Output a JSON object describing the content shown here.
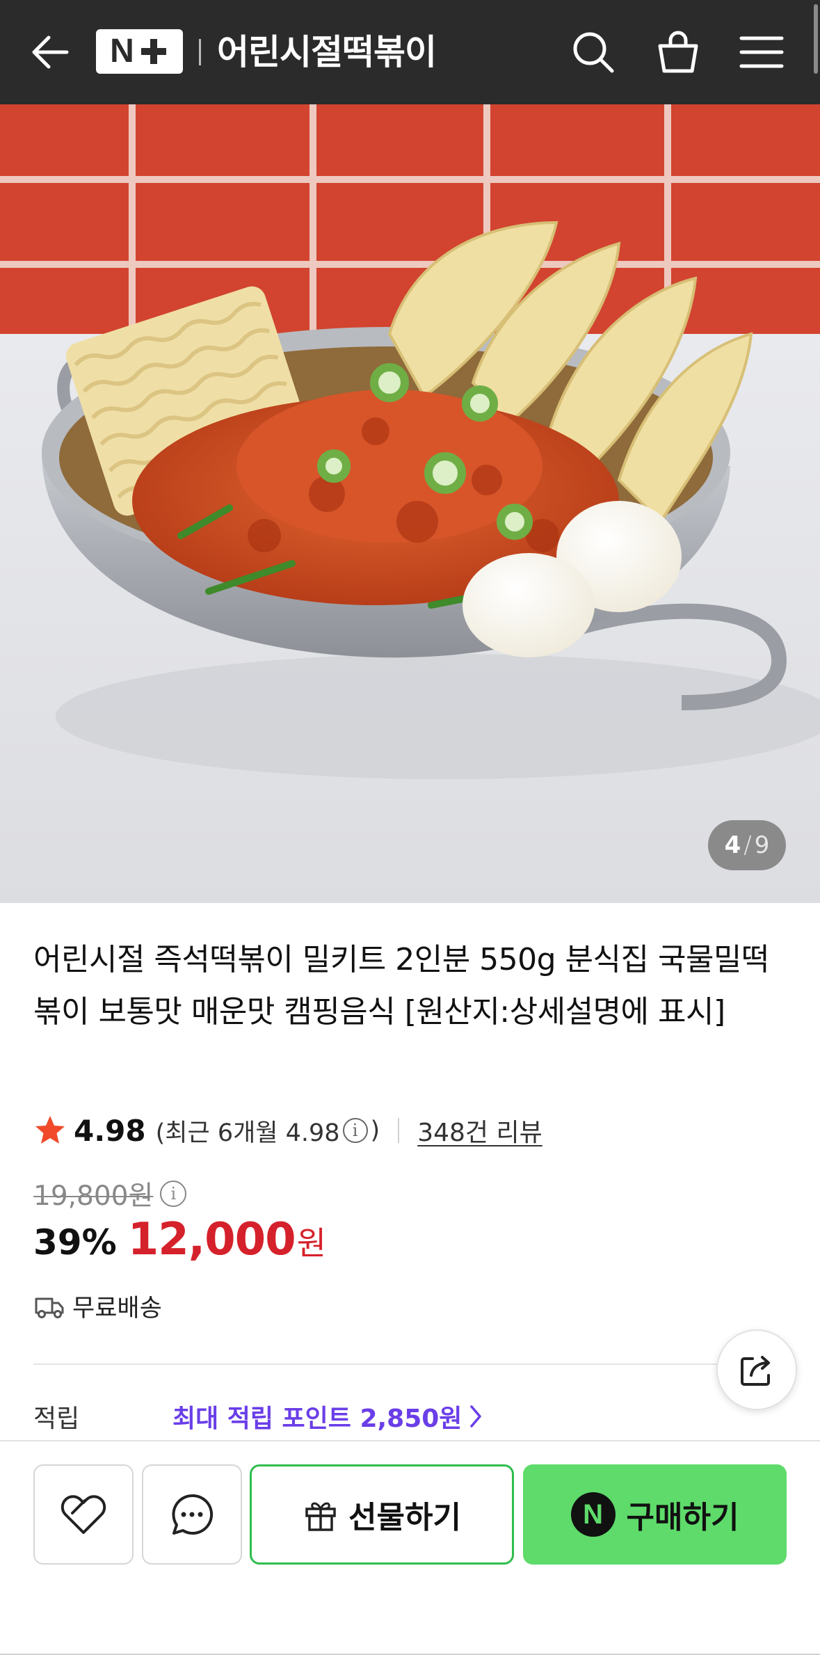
{
  "header": {
    "brand_badge": "N+",
    "store_name": "어린시절떡볶이",
    "icons": [
      "back-arrow-icon",
      "search-icon",
      "shopping-bag-icon",
      "hamburger-menu-icon"
    ],
    "background_color": "#2b2b2b"
  },
  "gallery": {
    "current": "4",
    "separator": "/",
    "total": "9"
  },
  "product": {
    "title": "어린시절 즉석떡볶이 밀키트 2인분 550g 분식집 국물밀떡볶이 보통맛 매운맛 캠핑음식 [원산지:상세설명에 표시]",
    "rating": "4.98",
    "recent_rating_prefix": "(최근 6개월 4.98",
    "recent_rating_suffix": ")",
    "review_count": "348건 리뷰",
    "original_price": "19,800원",
    "discount": "39%",
    "price": "12,000",
    "currency": "원",
    "shipping": "무료배송"
  },
  "points": {
    "label": "적립",
    "text": "최대 적립 포인트 2,850원"
  },
  "actions": {
    "gift_label": "선물하기",
    "buy_label": "구매하기",
    "npay_letter": "N"
  },
  "colors": {
    "price_red": "#d5212b",
    "point_purple": "#6a3ee8",
    "buy_green": "#5edb6a",
    "gift_border_green": "#2fbd4f",
    "rating_star": "#f04a2a"
  }
}
